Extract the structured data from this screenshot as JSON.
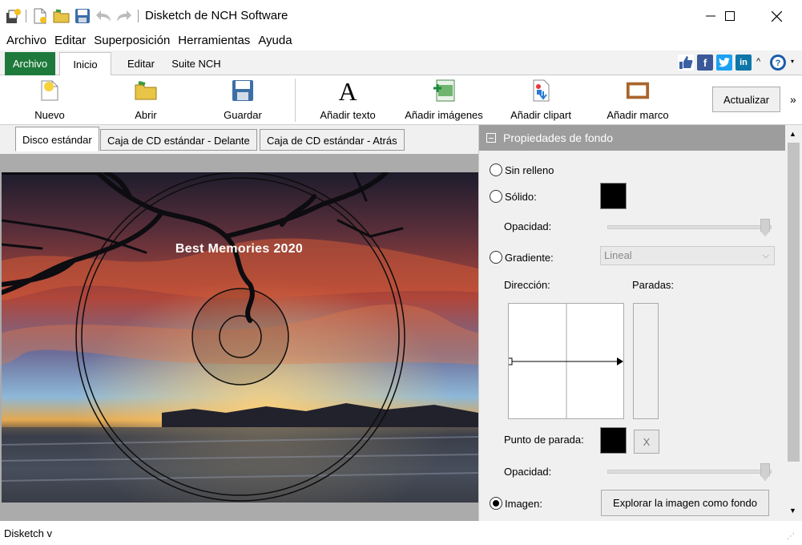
{
  "window": {
    "title": "Disketch de NCH Software"
  },
  "menu": [
    "Archivo",
    "Editar",
    "Superposición",
    "Herramientas",
    "Ayuda"
  ],
  "ribbon_tabs": {
    "file": "Archivo",
    "home": "Inicio",
    "edit": "Editar",
    "suite": "Suite NCH"
  },
  "ribbon": {
    "new": "Nuevo",
    "open": "Abrir",
    "save": "Guardar",
    "add_text": "Añadir texto",
    "add_images": "Añadir imágenes",
    "add_clipart": "Añadir clipart",
    "add_frame": "Añadir marco",
    "update": "Actualizar",
    "more": "»"
  },
  "doc_tabs": [
    "Disco estándar",
    "Caja de CD estándar - Delante",
    "Caja de CD estándar - Atrás"
  ],
  "disc": {
    "title": "Best Memories 2020"
  },
  "properties": {
    "header": "Propiedades de fondo",
    "no_fill": "Sin relleno",
    "solid": "Sólido:",
    "opacity": "Opacidad:",
    "gradient": "Gradiente:",
    "gradient_type": "Lineal",
    "direction": "Dirección:",
    "stops": "Paradas:",
    "stop_point": "Punto de parada:",
    "remove_stop": "X",
    "image": "Imagen:",
    "browse": "Explorar la imagen como fondo",
    "selected_option": "Imagen",
    "solid_color": "#000000",
    "stop_color": "#000000",
    "opacity_fill": 1.0,
    "opacity2_fill": 1.0
  },
  "statusbar": {
    "text": "Disketch v"
  },
  "colors": {
    "file_tab": "#1e7a3b",
    "panel_header": "#9d9d9d"
  }
}
